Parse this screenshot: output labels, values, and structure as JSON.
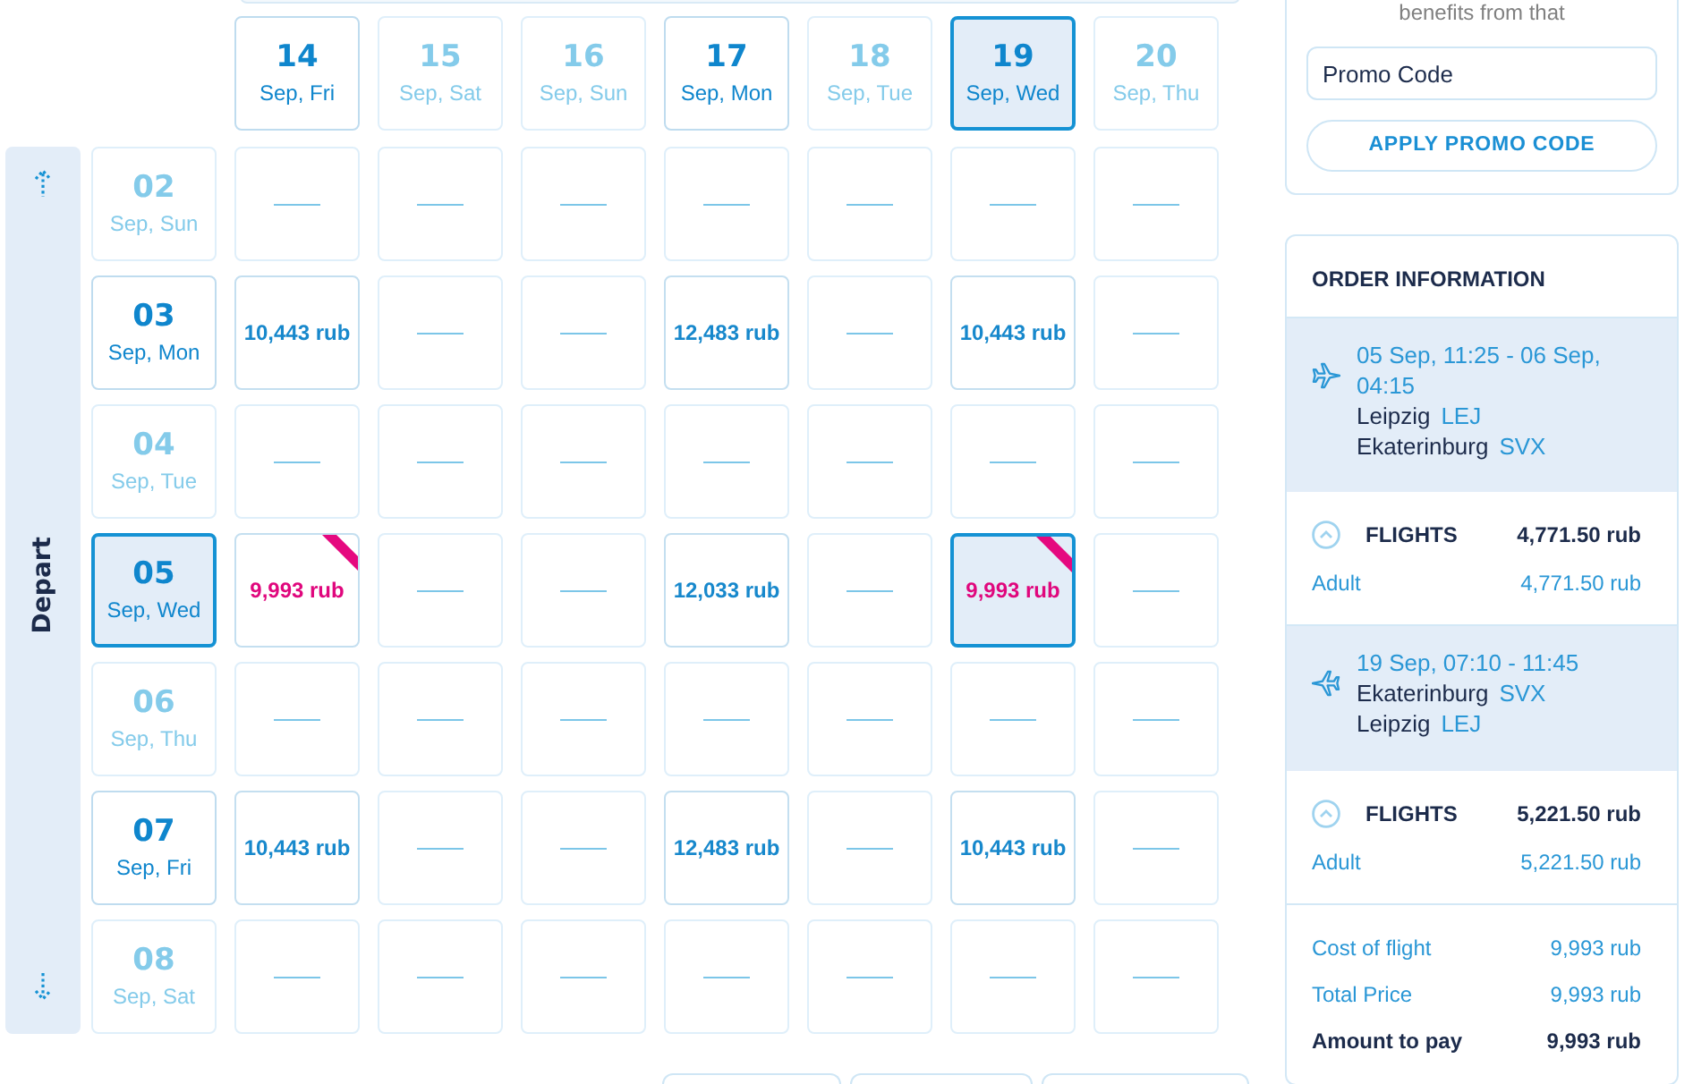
{
  "calendar": {
    "axis_label": "Depart",
    "return_dates": [
      {
        "day": "14",
        "label": "Sep, Fri",
        "available": true,
        "selected": false
      },
      {
        "day": "15",
        "label": "Sep, Sat",
        "available": false,
        "selected": false
      },
      {
        "day": "16",
        "label": "Sep, Sun",
        "available": false,
        "selected": false
      },
      {
        "day": "17",
        "label": "Sep, Mon",
        "available": true,
        "selected": false
      },
      {
        "day": "18",
        "label": "Sep, Tue",
        "available": false,
        "selected": false
      },
      {
        "day": "19",
        "label": "Sep, Wed",
        "available": true,
        "selected": true
      },
      {
        "day": "20",
        "label": "Sep, Thu",
        "available": false,
        "selected": false
      }
    ],
    "depart_rows": [
      {
        "day": "02",
        "label": "Sep, Sun",
        "available": false,
        "selected": false,
        "cells": [
          {
            "kind": "empty",
            "cheapest": false,
            "selected": false
          },
          {
            "kind": "empty",
            "cheapest": false,
            "selected": false
          },
          {
            "kind": "empty",
            "cheapest": false,
            "selected": false
          },
          {
            "kind": "empty",
            "cheapest": false,
            "selected": false
          },
          {
            "kind": "empty",
            "cheapest": false,
            "selected": false
          },
          {
            "kind": "empty",
            "cheapest": false,
            "selected": false
          },
          {
            "kind": "empty",
            "cheapest": false,
            "selected": false
          }
        ]
      },
      {
        "day": "03",
        "label": "Sep, Mon",
        "available": true,
        "selected": false,
        "cells": [
          {
            "kind": "price",
            "price": "10,443 rub",
            "cheapest": false,
            "selected": false
          },
          {
            "kind": "empty",
            "cheapest": false,
            "selected": false
          },
          {
            "kind": "empty",
            "cheapest": false,
            "selected": false
          },
          {
            "kind": "price",
            "price": "12,483 rub",
            "cheapest": false,
            "selected": false
          },
          {
            "kind": "empty",
            "cheapest": false,
            "selected": false
          },
          {
            "kind": "price",
            "price": "10,443 rub",
            "cheapest": false,
            "selected": false
          },
          {
            "kind": "empty",
            "cheapest": false,
            "selected": false
          }
        ]
      },
      {
        "day": "04",
        "label": "Sep, Tue",
        "available": false,
        "selected": false,
        "cells": [
          {
            "kind": "empty",
            "cheapest": false,
            "selected": false
          },
          {
            "kind": "empty",
            "cheapest": false,
            "selected": false
          },
          {
            "kind": "empty",
            "cheapest": false,
            "selected": false
          },
          {
            "kind": "empty",
            "cheapest": false,
            "selected": false
          },
          {
            "kind": "empty",
            "cheapest": false,
            "selected": false
          },
          {
            "kind": "empty",
            "cheapest": false,
            "selected": false
          },
          {
            "kind": "empty",
            "cheapest": false,
            "selected": false
          }
        ]
      },
      {
        "day": "05",
        "label": "Sep, Wed",
        "available": true,
        "selected": true,
        "cells": [
          {
            "kind": "price",
            "price": "9,993 rub",
            "cheapest": true,
            "selected": false
          },
          {
            "kind": "empty",
            "cheapest": false,
            "selected": false
          },
          {
            "kind": "empty",
            "cheapest": false,
            "selected": false
          },
          {
            "kind": "price",
            "price": "12,033 rub",
            "cheapest": false,
            "selected": false
          },
          {
            "kind": "empty",
            "cheapest": false,
            "selected": false
          },
          {
            "kind": "price",
            "price": "9,993 rub",
            "cheapest": true,
            "selected": true
          },
          {
            "kind": "empty",
            "cheapest": false,
            "selected": false
          }
        ]
      },
      {
        "day": "06",
        "label": "Sep, Thu",
        "available": false,
        "selected": false,
        "cells": [
          {
            "kind": "empty",
            "cheapest": false,
            "selected": false
          },
          {
            "kind": "empty",
            "cheapest": false,
            "selected": false
          },
          {
            "kind": "empty",
            "cheapest": false,
            "selected": false
          },
          {
            "kind": "empty",
            "cheapest": false,
            "selected": false
          },
          {
            "kind": "empty",
            "cheapest": false,
            "selected": false
          },
          {
            "kind": "empty",
            "cheapest": false,
            "selected": false
          },
          {
            "kind": "empty",
            "cheapest": false,
            "selected": false
          }
        ]
      },
      {
        "day": "07",
        "label": "Sep, Fri",
        "available": true,
        "selected": false,
        "cells": [
          {
            "kind": "price",
            "price": "10,443 rub",
            "cheapest": false,
            "selected": false
          },
          {
            "kind": "empty",
            "cheapest": false,
            "selected": false
          },
          {
            "kind": "empty",
            "cheapest": false,
            "selected": false
          },
          {
            "kind": "price",
            "price": "12,483 rub",
            "cheapest": false,
            "selected": false
          },
          {
            "kind": "empty",
            "cheapest": false,
            "selected": false
          },
          {
            "kind": "price",
            "price": "10,443 rub",
            "cheapest": false,
            "selected": false
          },
          {
            "kind": "empty",
            "cheapest": false,
            "selected": false
          }
        ]
      },
      {
        "day": "08",
        "label": "Sep, Sat",
        "available": false,
        "selected": false,
        "cells": [
          {
            "kind": "empty",
            "cheapest": false,
            "selected": false
          },
          {
            "kind": "empty",
            "cheapest": false,
            "selected": false
          },
          {
            "kind": "empty",
            "cheapest": false,
            "selected": false
          },
          {
            "kind": "empty",
            "cheapest": false,
            "selected": false
          },
          {
            "kind": "empty",
            "cheapest": false,
            "selected": false
          },
          {
            "kind": "empty",
            "cheapest": false,
            "selected": false
          },
          {
            "kind": "empty",
            "cheapest": false,
            "selected": false
          }
        ]
      }
    ]
  },
  "promo": {
    "intro_text": "benefits from that",
    "code_field": {
      "value": "Promo Code"
    },
    "apply_button": "APPLY PROMO CODE"
  },
  "order": {
    "title": "ORDER INFORMATION",
    "segments": [
      {
        "kind": "outbound",
        "times": "05 Sep, 11:25 - 06 Sep, 04:15",
        "from_city": "Leipzig",
        "from_code": "LEJ",
        "to_city": "Ekaterinburg",
        "to_code": "SVX",
        "fare": {
          "title": "FLIGHTS",
          "total": "4,771.50 rub",
          "expanded": true,
          "passengers": [
            {
              "type": "Adult",
              "price": "4,771.50 rub"
            }
          ]
        }
      },
      {
        "kind": "return",
        "times": "19 Sep, 07:10 - 11:45",
        "from_city": "Ekaterinburg",
        "from_code": "SVX",
        "to_city": "Leipzig",
        "to_code": "LEJ",
        "fare": {
          "title": "FLIGHTS",
          "total": "5,221.50 rub",
          "expanded": true,
          "passengers": [
            {
              "type": "Adult",
              "price": "5,221.50 rub"
            }
          ]
        }
      }
    ],
    "totals": [
      {
        "kind": "line",
        "label": "Cost of flight",
        "value": "9,993 rub"
      },
      {
        "kind": "line",
        "label": "Total Price",
        "value": "9,993 rub"
      },
      {
        "kind": "due",
        "label": "Amount to pay",
        "value": "9,993 rub"
      }
    ]
  }
}
